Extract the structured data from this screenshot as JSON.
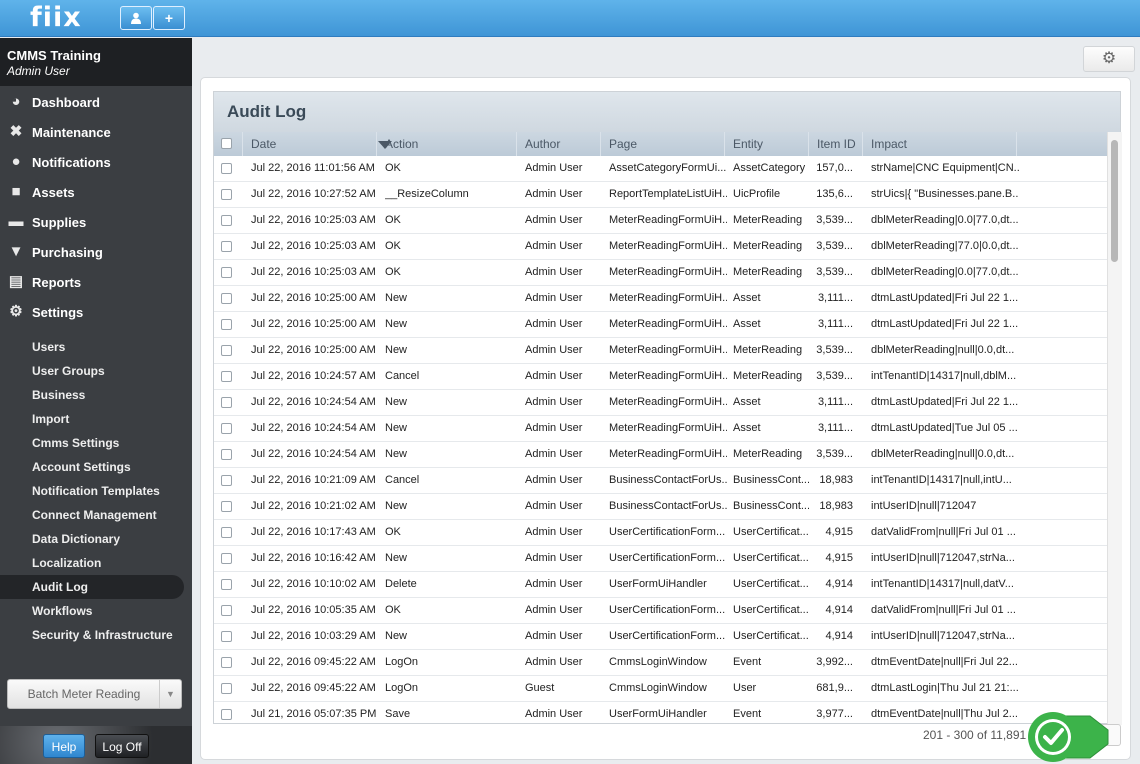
{
  "app": {
    "logo": "fiix",
    "add_label": "+",
    "org_name": "CMMS Training",
    "user_name": "Admin User"
  },
  "nav": {
    "main_items": [
      {
        "label": "Dashboard",
        "icon": "dashboard-icon"
      },
      {
        "label": "Maintenance",
        "icon": "wrench-icon"
      },
      {
        "label": "Notifications",
        "icon": "chat-bubble-icon"
      },
      {
        "label": "Assets",
        "icon": "box-icon"
      },
      {
        "label": "Supplies",
        "icon": "truck-icon"
      },
      {
        "label": "Purchasing",
        "icon": "cart-icon"
      },
      {
        "label": "Reports",
        "icon": "chart-icon"
      },
      {
        "label": "Settings",
        "icon": "gear-icon"
      }
    ],
    "settings_items": [
      "Users",
      "User Groups",
      "Business",
      "Import",
      "Cmms Settings",
      "Account Settings",
      "Notification Templates",
      "Connect Management",
      "Data Dictionary",
      "Localization",
      "Audit Log",
      "Workflows",
      "Security & Infrastructure"
    ],
    "active_item": "Audit Log",
    "batch_button": "Batch Meter Reading"
  },
  "footer": {
    "help": "Help",
    "logoff": "Log Off"
  },
  "grid": {
    "title": "Audit Log",
    "columns": [
      "Date",
      "Action",
      "Author",
      "Page",
      "Entity",
      "Item ID",
      "Impact"
    ],
    "sorted_column": "Date",
    "rows": [
      [
        "Jul 22, 2016 11:01:56 AM",
        "OK",
        "Admin User",
        "AssetCategoryFormUi...",
        "AssetCategory",
        "157,0...",
        "strName|CNC Equipment|CN..."
      ],
      [
        "Jul 22, 2016 10:27:52 AM",
        "__ResizeColumn",
        "Admin User",
        "ReportTemplateListUiH...",
        "UicProfile",
        "135,6...",
        "strUics|{ \"Businesses.pane.B..."
      ],
      [
        "Jul 22, 2016 10:25:03 AM",
        "OK",
        "Admin User",
        "MeterReadingFormUiH...",
        "MeterReading",
        "3,539...",
        "dblMeterReading|0.0|77.0,dt..."
      ],
      [
        "Jul 22, 2016 10:25:03 AM",
        "OK",
        "Admin User",
        "MeterReadingFormUiH...",
        "MeterReading",
        "3,539...",
        "dblMeterReading|77.0|0.0,dt..."
      ],
      [
        "Jul 22, 2016 10:25:03 AM",
        "OK",
        "Admin User",
        "MeterReadingFormUiH...",
        "MeterReading",
        "3,539...",
        "dblMeterReading|0.0|77.0,dt..."
      ],
      [
        "Jul 22, 2016 10:25:00 AM",
        "New",
        "Admin User",
        "MeterReadingFormUiH...",
        "Asset",
        "3,111...",
        "dtmLastUpdated|Fri Jul 22 1..."
      ],
      [
        "Jul 22, 2016 10:25:00 AM",
        "New",
        "Admin User",
        "MeterReadingFormUiH...",
        "Asset",
        "3,111...",
        "dtmLastUpdated|Fri Jul 22 1..."
      ],
      [
        "Jul 22, 2016 10:25:00 AM",
        "New",
        "Admin User",
        "MeterReadingFormUiH...",
        "MeterReading",
        "3,539...",
        "dblMeterReading|null|0.0,dt..."
      ],
      [
        "Jul 22, 2016 10:24:57 AM",
        "Cancel",
        "Admin User",
        "MeterReadingFormUiH...",
        "MeterReading",
        "3,539...",
        "intTenantID|14317|null,dblM..."
      ],
      [
        "Jul 22, 2016 10:24:54 AM",
        "New",
        "Admin User",
        "MeterReadingFormUiH...",
        "Asset",
        "3,111...",
        "dtmLastUpdated|Fri Jul 22 1..."
      ],
      [
        "Jul 22, 2016 10:24:54 AM",
        "New",
        "Admin User",
        "MeterReadingFormUiH...",
        "Asset",
        "3,111...",
        "dtmLastUpdated|Tue Jul 05 ..."
      ],
      [
        "Jul 22, 2016 10:24:54 AM",
        "New",
        "Admin User",
        "MeterReadingFormUiH...",
        "MeterReading",
        "3,539...",
        "dblMeterReading|null|0.0,dt..."
      ],
      [
        "Jul 22, 2016 10:21:09 AM",
        "Cancel",
        "Admin User",
        "BusinessContactForUs...",
        "BusinessCont...",
        "18,983",
        "intTenantID|14317|null,intU..."
      ],
      [
        "Jul 22, 2016 10:21:02 AM",
        "New",
        "Admin User",
        "BusinessContactForUs...",
        "BusinessCont...",
        "18,983",
        "intUserID|null|712047"
      ],
      [
        "Jul 22, 2016 10:17:43 AM",
        "OK",
        "Admin User",
        "UserCertificationForm...",
        "UserCertificat...",
        "4,915",
        "datValidFrom|null|Fri Jul 01 ..."
      ],
      [
        "Jul 22, 2016 10:16:42 AM",
        "New",
        "Admin User",
        "UserCertificationForm...",
        "UserCertificat...",
        "4,915",
        "intUserID|null|712047,strNa..."
      ],
      [
        "Jul 22, 2016 10:10:02 AM",
        "Delete",
        "Admin User",
        "UserFormUiHandler",
        "UserCertificat...",
        "4,914",
        "intTenantID|14317|null,datV..."
      ],
      [
        "Jul 22, 2016 10:05:35 AM",
        "OK",
        "Admin User",
        "UserCertificationForm...",
        "UserCertificat...",
        "4,914",
        "datValidFrom|null|Fri Jul 01 ..."
      ],
      [
        "Jul 22, 2016 10:03:29 AM",
        "New",
        "Admin User",
        "UserCertificationForm...",
        "UserCertificat...",
        "4,914",
        "intUserID|null|712047,strNa..."
      ],
      [
        "Jul 22, 2016 09:45:22 AM",
        "LogOn",
        "Admin User",
        "CmmsLoginWindow",
        "Event",
        "3,992...",
        "dtmEventDate|null|Fri Jul 22..."
      ],
      [
        "Jul 22, 2016 09:45:22 AM",
        "LogOn",
        "Guest",
        "CmmsLoginWindow",
        "User",
        "681,9...",
        "dtmLastLogin|Thu Jul 21 21:..."
      ],
      [
        "Jul 21, 2016 05:07:35 PM",
        "Save",
        "Admin User",
        "UserFormUiHandler",
        "Event",
        "3,977...",
        "dtmEventDate|null|Thu Jul 2..."
      ]
    ],
    "pager_text": "201 - 300 of 11,891",
    "next_label": "›"
  }
}
